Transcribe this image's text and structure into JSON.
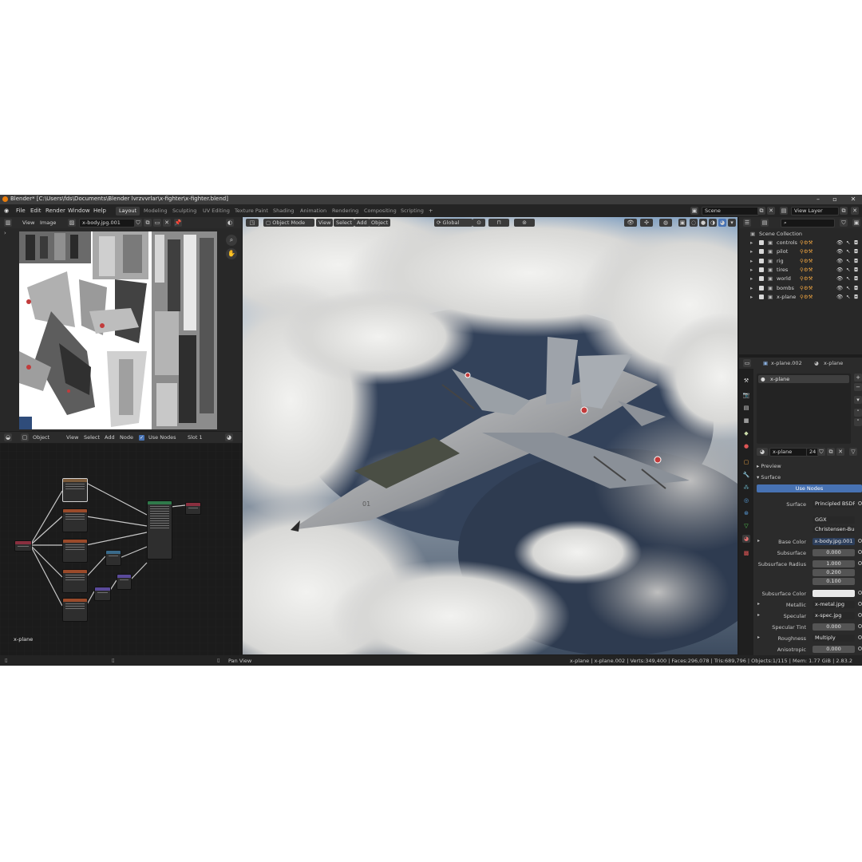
{
  "window": {
    "title": "Blender* [C:\\Users\\fds\\Documents\\Blender lvrzvvrlar\\x-fighter\\x-fighter.blend]"
  },
  "menus": [
    "File",
    "Edit",
    "Render",
    "Window",
    "Help"
  ],
  "workspaces": [
    "Layout",
    "Modeling",
    "Sculpting",
    "UV Editing",
    "Texture Paint",
    "Shading",
    "Animation",
    "Rendering",
    "Compositing",
    "Scripting"
  ],
  "topbar": {
    "add_tab": "+",
    "scene": "Scene",
    "view_layer": "View Layer"
  },
  "image_editor": {
    "view": "View",
    "image": "Image",
    "image_name": "x-body.jpg.001"
  },
  "node_editor": {
    "object": "Object",
    "view": "View",
    "select": "Select",
    "add": "Add",
    "node": "Node",
    "use_nodes": "Use Nodes",
    "slot": "Slot 1",
    "material_label": "x-plane"
  },
  "viewport": {
    "mode": "Object Mode",
    "view": "View",
    "select": "Select",
    "add": "Add",
    "object": "Object",
    "orientation": "Global",
    "plane_number": "01"
  },
  "outliner": {
    "collection": "Scene Collection",
    "items": [
      "controls",
      "pilot",
      "rig",
      "tires",
      "world",
      "bombs",
      "x-plane"
    ]
  },
  "properties": {
    "object_name": "x-plane.002",
    "material_tab": "x-plane",
    "slot_material": "x-plane",
    "material_name": "x-plane",
    "user_count": "24",
    "preview": "Preview",
    "surface_section": "Surface",
    "use_nodes": "Use Nodes",
    "rows": {
      "surface": {
        "label": "Surface",
        "value": "Principled BSDF"
      },
      "distribution": "GGX",
      "subsurface_method": "Christensen-Burley",
      "base_color": {
        "label": "Base Color",
        "value": "x-body.jpg.001"
      },
      "subsurface": {
        "label": "Subsurface",
        "value": "0.000"
      },
      "subsurface_radius": {
        "label": "Subsurface Radius",
        "values": [
          "1.000",
          "0.200",
          "0.100"
        ]
      },
      "subsurface_color": {
        "label": "Subsurface Color"
      },
      "metallic": {
        "label": "Metallic",
        "value": "x-metal.jpg"
      },
      "specular": {
        "label": "Specular",
        "value": "x-spec.jpg"
      },
      "specular_tint": {
        "label": "Specular Tint",
        "value": "0.000"
      },
      "roughness": {
        "label": "Roughness",
        "value": "Multiply"
      },
      "anisotropic": {
        "label": "Anisotropic",
        "value": "0.000"
      }
    }
  },
  "statusbar": {
    "hint": "Pan View",
    "stats": "x-plane | x-plane.002 | Verts:349,400 | Faces:296,078 | Tris:689,796 | Objects:1/115 | Mem: 1.77 GiB | 2.83.2"
  },
  "colors": {
    "accent": "#4772b3",
    "orange": "#e87d0d",
    "bg": "#1d1d1d",
    "panel": "#303030"
  }
}
